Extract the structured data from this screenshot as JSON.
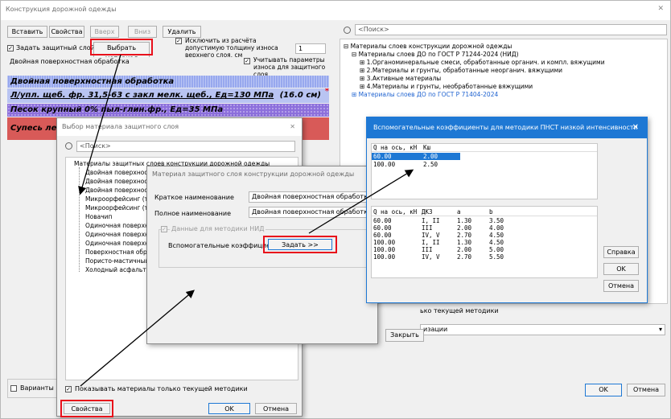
{
  "main": {
    "title": "Конструкция дорожной одежды",
    "close": "✕",
    "toolbar": {
      "insert": "Вставить",
      "props": "Свойства",
      "up": "Вверх",
      "down": "Вниз",
      "delete": "Удалить"
    },
    "protective_layer_label": "Задать защитный слой",
    "choose_material": "Выбрать материал",
    "exclude_label": "Исключить из расчёта допустимую толщину износа верхнего слоя, см",
    "exclude_value": "1",
    "consider_label": "Учитывать параметры износа для защитного слоя",
    "combo_value": "Двойная поверхностная обработка",
    "layers": [
      {
        "text": "Двойная поверхностная обработка",
        "thick": ""
      },
      {
        "text": "Л/упл. щеб. фр. 31,5-63 с закл мелк. щеб., Ед=130 МПа",
        "thick": "(16.0 см)"
      },
      {
        "text": "Песок крупный 0% пыл-глин.фр., Ед=35 МПа",
        "thick": ""
      },
      {
        "text": "Супесь легкая",
        "thick": ""
      }
    ],
    "search_placeholder": "<Поиск>",
    "tree": [
      "Материалы слоев конструкции дорожной одежды",
      "Материалы слоев ДО по ГОСТ Р 71244-2024 (НИД)",
      "1.Органоминеральные смеси, обработанные органич. и компл. вяжущими",
      "2.Материалы и грунты, обработанные неорганич. вяжущими",
      "3.Активные материалы",
      "4.Материалы и грунты, необработанные вяжущими",
      "Материалы слоев ДО по ГОСТ Р 71404-2024"
    ],
    "only_current_label": "Показывать материалы только текущей методики",
    "variants_label": "Варианты к",
    "combo2_value": "изации",
    "close_button": "Закрыть",
    "ok": "OK",
    "cancel": "Отмена"
  },
  "picker": {
    "title": "Выбор материала защитного слоя",
    "search_placeholder": "<Поиск>",
    "root": "Материалы защитных слоев конструкции дорожной одежды",
    "items": [
      "Двойная поверхност",
      "Двойная поверхност",
      "Двойная поверхност",
      "Микроорфейсинг (ти",
      "Микроорфейсинг (ти",
      "Новачип",
      "Одиночная поверхнос",
      "Одиночная поверхнос",
      "Одиночная поверхнос",
      "Поверхностная обраб",
      "Пористо-мастичный а",
      "Холодный асфальтоб"
    ],
    "show_only_label": "Показывать материалы только текущей методики",
    "props": "Свойства",
    "ok": "OK",
    "cancel": "Отмена"
  },
  "material": {
    "title": "Материал защитного слоя конструкции дорожной одежды",
    "short_label": "Краткое наименование",
    "short_value": "Двойная поверхностная обработка",
    "full_label": "Полное наименование",
    "full_value": "Двойная поверхностная обработка",
    "group_label": "Данные для методики НИД",
    "coef_label": "Вспомогательные коэффициенты:",
    "set_button": "Задать >>"
  },
  "coef": {
    "title": "Вспомогательные коэффициенты для методики ПНСТ низкой интенсивности",
    "close": "✕",
    "t1_headers": [
      "Q на ось, кН",
      "Кш"
    ],
    "t1_rows": [
      [
        "60.00",
        "2.00"
      ],
      [
        "100.00",
        "2.50"
      ]
    ],
    "t2_headers": [
      "Q на ось, кН",
      "ДКЗ",
      "a",
      "b"
    ],
    "t2_rows": [
      [
        "60.00",
        "I, II",
        "1.30",
        "3.50"
      ],
      [
        "60.00",
        "III",
        "2.00",
        "4.00"
      ],
      [
        "60.00",
        "IV, V",
        "2.70",
        "4.50"
      ],
      [
        "100.00",
        "I, II",
        "1.30",
        "4.50"
      ],
      [
        "100.00",
        "III",
        "2.00",
        "5.00"
      ],
      [
        "100.00",
        "IV, V",
        "2.70",
        "5.50"
      ]
    ],
    "help": "Справка",
    "ok": "OK",
    "cancel": "Отмена",
    "bottom_text": "ько текущей методики"
  },
  "colors": {
    "accent": "#1e78d4",
    "red": "#e8101b",
    "layer1": "#97a8ee",
    "layer2": "#b9c4f2",
    "layer3": "#8c6fdc",
    "layer4": "#d85a58"
  }
}
